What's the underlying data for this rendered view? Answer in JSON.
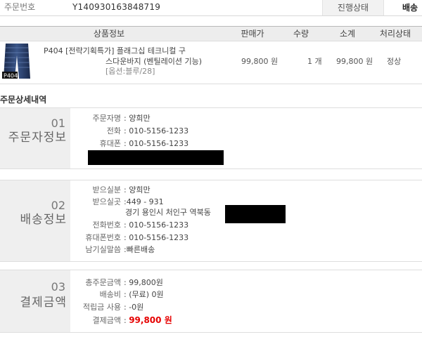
{
  "order_bar": {
    "order_no_label": "주문번호",
    "order_no": "Y140930163848719",
    "status_label": "진행상태",
    "status_value": "배송"
  },
  "product_table": {
    "headers": {
      "product": "상품정보",
      "price": "판매가",
      "qty": "수량",
      "subtotal": "소계",
      "status": "처리상태"
    },
    "rows": [
      {
        "thumb_label": "P404",
        "name_lines": [
          "P404 [전략기획특가] 플래그십 테크니컬 구",
          "스다운바지 (벤틸레이션 기능)"
        ],
        "option": "[옵션:블루/28]",
        "price": "99,800 원",
        "qty": "1 개",
        "subtotal": "99,800 원",
        "status": "정상"
      }
    ]
  },
  "detail_heading": "주문상세내역",
  "sections": [
    {
      "number": "01",
      "title": "주문자정보",
      "fields": [
        {
          "label": "주문자명",
          "sep": ": ",
          "value": "양희만"
        },
        {
          "label": "전화",
          "sep": ": ",
          "value": "010-5156-1233"
        },
        {
          "label": "휴대폰",
          "sep": ": ",
          "value": "010-5156-1233"
        }
      ]
    },
    {
      "number": "02",
      "title": "배송정보",
      "fields": [
        {
          "label": "받으실분",
          "sep": ": ",
          "value": "양희만"
        },
        {
          "label": "받으실곳",
          "sep": ":",
          "value": "449 - 931",
          "address_line": "경기 용인시 처인구 역북동"
        },
        {
          "label": "전화번호",
          "sep": ": ",
          "value": "010-5156-1233"
        },
        {
          "label": "휴대폰번호",
          "sep": ": ",
          "value": "010-5156-1233"
        },
        {
          "label": "남기실말씀",
          "sep": ":",
          "value": "빠른배송"
        }
      ]
    },
    {
      "number": "03",
      "title": "결제금액",
      "fields": [
        {
          "label": "총주문금액",
          "sep": ": ",
          "value": "99,800원"
        },
        {
          "label": "배송비",
          "sep": ": ",
          "value": "(무료) 0원"
        },
        {
          "label": "적립금 사용",
          "sep": ": ",
          "value": "-0원"
        },
        {
          "label": "결제금액",
          "sep": ": ",
          "value": "99,800 원"
        }
      ]
    }
  ],
  "colors": {
    "total_amount": "#e60000",
    "label_panel": "#efefef",
    "header_bg": "#ededed"
  }
}
